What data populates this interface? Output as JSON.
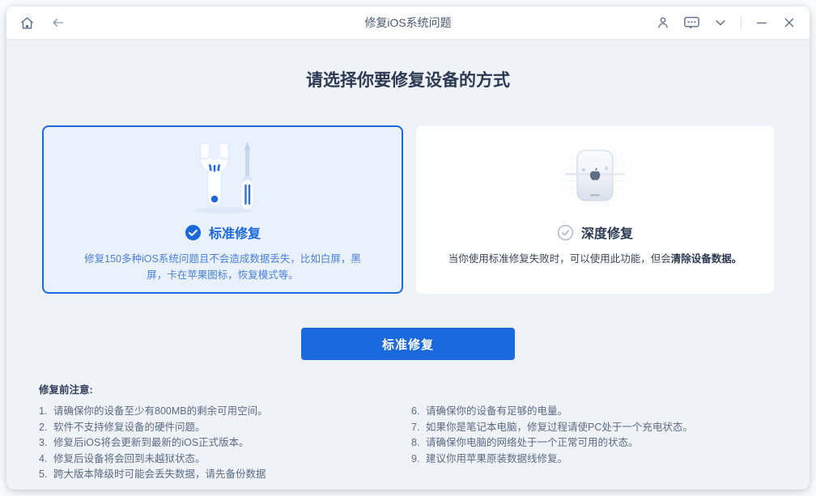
{
  "titlebar": {
    "title": "修复iOS系统问题"
  },
  "main": {
    "heading": "请选择你要修复设备的方式",
    "cards": [
      {
        "title": "标准修复",
        "description": "修复150多种iOS系统问题且不会造成数据丢失，比如白屏，黑屏，卡在苹果图标，恢复模式等。",
        "selected": true
      },
      {
        "title": "深度修复",
        "description": "当你使用标准修复失败时，可以使用此功能，但会",
        "description_bold": "清除设备数据。",
        "selected": false
      }
    ],
    "action_button": "标准修复",
    "notes": {
      "heading": "修复前注意:",
      "left": [
        {
          "num": "1.",
          "text": "请确保你的设备至少有800MB的剩余可用空间。"
        },
        {
          "num": "2.",
          "text": "软件不支持修复设备的硬件问题。"
        },
        {
          "num": "3.",
          "text": "修复后iOS将会更新到最新的iOS正式版本。"
        },
        {
          "num": "4.",
          "text": "修复后设备将会回到未越狱状态。"
        },
        {
          "num": "5.",
          "text": "跨大版本降级时可能会丢失数据，请先备份数据"
        }
      ],
      "right": [
        {
          "num": "6.",
          "text": "请确保你的设备有足够的电量。"
        },
        {
          "num": "7.",
          "text": "如果你是笔记本电脑，修复过程请使PC处于一个充电状态。"
        },
        {
          "num": "8.",
          "text": "请确保你电脑的网络处于一个正常可用的状态。"
        },
        {
          "num": "9.",
          "text": "建议你用苹果原装数据线修复。"
        }
      ]
    }
  },
  "icons": {
    "titlebar_left": [
      "home-icon",
      "back-arrow-icon"
    ],
    "titlebar_right": [
      "user-icon",
      "feedback-bubble-icon",
      "chevron-down-icon",
      "minimize-icon",
      "close-icon"
    ],
    "card_icons": [
      "wrench-screwdriver-icon",
      "device-apple-icon"
    ],
    "card_badges": [
      "check-circle-filled-icon",
      "check-circle-outline-icon"
    ]
  },
  "colors": {
    "accent": "#1C68DD",
    "selected_card_bg": "#E9F1FC",
    "content_bg": "#EFF3F8",
    "card_bg": "#FFFFFF",
    "heading_text": "#2B3A52",
    "selected_desc_text": "#4B80DB",
    "muted_text": "#5C6B84",
    "titlebar_icon": "#5A6B85"
  }
}
